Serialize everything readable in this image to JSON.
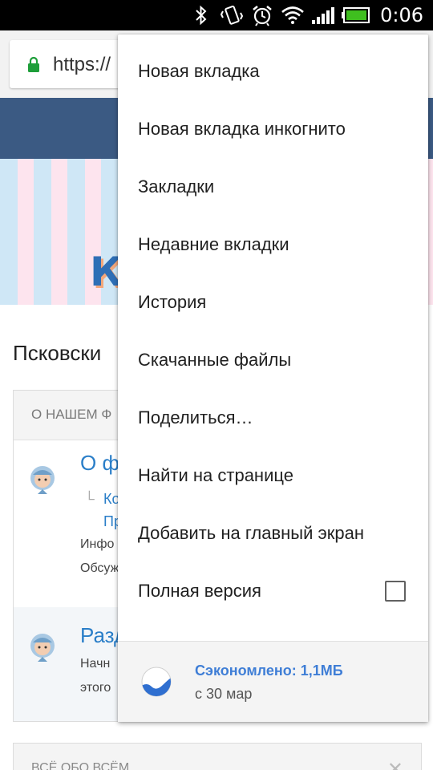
{
  "status_bar": {
    "time": "0:06",
    "icons": [
      "bluetooth-icon",
      "vibrate-icon",
      "alarm-icon",
      "wifi-icon",
      "signal-icon",
      "battery-icon"
    ],
    "battery_color": "#3fbf1f"
  },
  "browser": {
    "url": "https://",
    "lock_color": "#1e9e3a"
  },
  "page": {
    "title": "Псковски",
    "section1": {
      "header": "О НАШЕМ Ф",
      "row1": {
        "title": "О фо",
        "sub1": "Ко",
        "sub2": "Пр",
        "text1": "Инфо",
        "text2": "Обсуж"
      },
      "row2": {
        "title": "Разд",
        "text1": "Начн",
        "text2": "этого"
      }
    },
    "section2": {
      "header": "ВСЁ ОБО ВСЁМ"
    },
    "colors": {
      "header_band": "#3b5a83",
      "link": "#2a7ec8"
    }
  },
  "menu": {
    "items": [
      {
        "label": "Новая вкладка"
      },
      {
        "label": "Новая вкладка инкогнито"
      },
      {
        "label": "Закладки"
      },
      {
        "label": "Недавние вкладки"
      },
      {
        "label": "История"
      },
      {
        "label": "Скачанные файлы"
      },
      {
        "label": "Поделиться…"
      },
      {
        "label": "Найти на странице"
      },
      {
        "label": "Добавить на главный экран"
      },
      {
        "label": "Полная версия",
        "checked": false
      }
    ],
    "footer": {
      "title": "Сэкономлено: 1,1МБ",
      "subtitle": "с 30 мар",
      "accent": "#3f7ed6"
    }
  }
}
